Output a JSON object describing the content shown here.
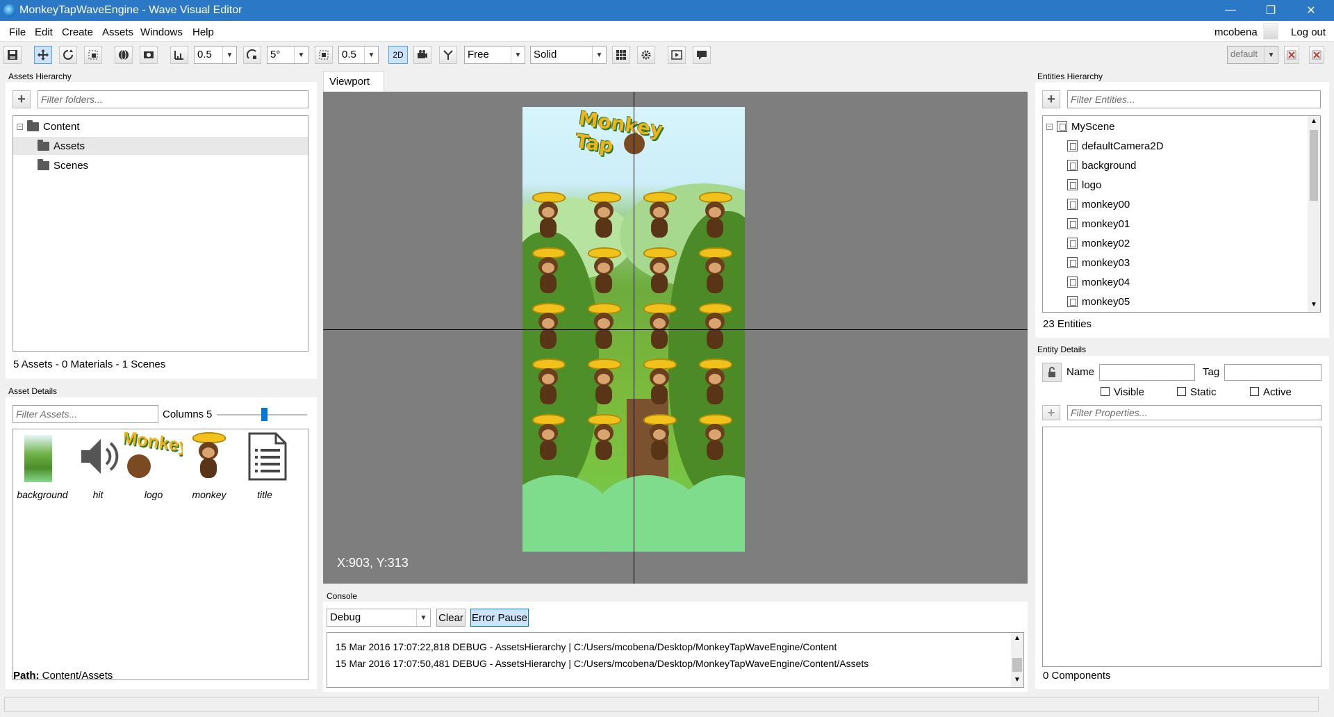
{
  "window": {
    "title": "MonkeyTapWaveEngine - Wave Visual Editor",
    "minimize": "—",
    "maximize": "❐",
    "close": "✕"
  },
  "menu": {
    "items": [
      "File",
      "Edit",
      "Create",
      "Assets",
      "Windows",
      "Help"
    ],
    "user": "mcobena",
    "logout": "Log out"
  },
  "toolbar": {
    "translate_snap": "0.5",
    "rotate_snap": "5°",
    "scale_snap": "0.5",
    "mode_2d": "2D",
    "camera_mode": "Free",
    "render_mode": "Solid",
    "layout": "default"
  },
  "assets_hierarchy": {
    "title": "Assets Hierarchy",
    "filter_placeholder": "Filter folders...",
    "tree": {
      "root": "Content",
      "children": [
        "Assets",
        "Scenes"
      ]
    },
    "summary": "5 Assets - 0 Materials - 1 Scenes"
  },
  "asset_details": {
    "title": "Asset Details",
    "filter_placeholder": "Filter Assets...",
    "columns_label": "Columns",
    "columns_value": "5",
    "columns_slider_fraction": 0.52,
    "items": [
      "background",
      "hit",
      "logo",
      "monkey",
      "title"
    ],
    "path_label": "Path:",
    "path_value": "Content/Assets"
  },
  "viewport": {
    "tab": "Viewport",
    "coords": "X:903, Y:313",
    "logo_text": "Monkey Tap"
  },
  "console": {
    "title": "Console",
    "level": "Debug",
    "clear": "Clear",
    "error_pause": "Error Pause",
    "lines": [
      "15 Mar 2016 17:07:22,818 DEBUG - AssetsHierarchy | C:/Users/mcobena/Desktop/MonkeyTapWaveEngine/Content",
      "15 Mar 2016 17:07:50,481 DEBUG - AssetsHierarchy | C:/Users/mcobena/Desktop/MonkeyTapWaveEngine/Content/Assets"
    ]
  },
  "entities_hierarchy": {
    "title": "Entities Hierarchy",
    "filter_placeholder": "Filter Entities...",
    "scene": "MyScene",
    "entities": [
      "defaultCamera2D",
      "background",
      "logo",
      "monkey00",
      "monkey01",
      "monkey02",
      "monkey03",
      "monkey04",
      "monkey05"
    ],
    "count": "23 Entities"
  },
  "entity_details": {
    "title": "Entity Details",
    "name_label": "Name",
    "tag_label": "Tag",
    "visible": "Visible",
    "static": "Static",
    "active": "Active",
    "filter_placeholder": "Filter Properties...",
    "components": "0 Components"
  },
  "colors": {
    "titlebar": "#2b78c6",
    "accent": "#cce4fb",
    "viewport_bg": "#7e7e7e"
  }
}
